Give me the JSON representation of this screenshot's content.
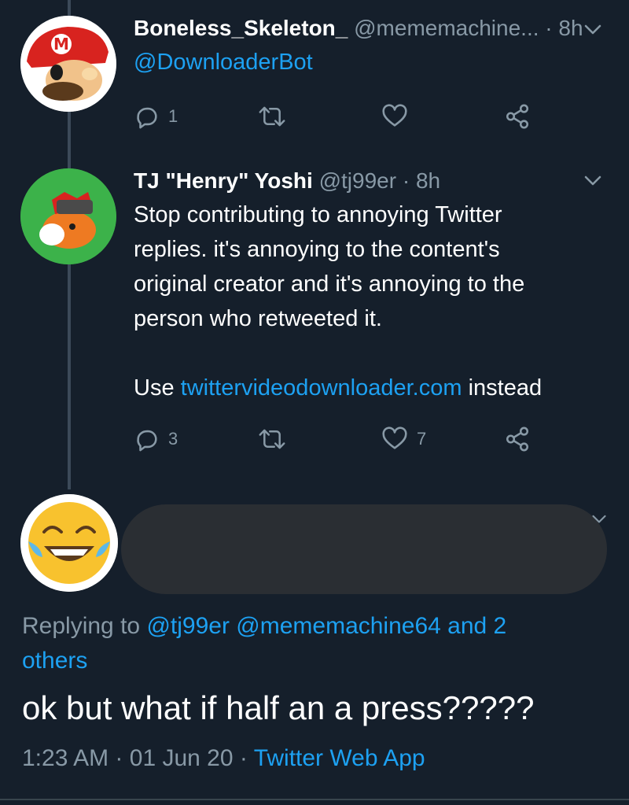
{
  "tweet1": {
    "name": "Boneless_Skeleton_",
    "handle": "@mememachine64",
    "handle_display": "@mememachine...",
    "time": "· 8h",
    "text_mention": "@DownloaderBot",
    "reply_count": "1",
    "retweet_count": "",
    "like_count": ""
  },
  "tweet2": {
    "name": "TJ \"Henry\" Yoshi",
    "handle": "@tj99er",
    "time": "· 8h",
    "text_lines": [
      "Stop contributing to annoying Twitter",
      "replies. it's annoying to the content's",
      "original creator and it's annoying to the",
      "person who retweeted it."
    ],
    "text_use": "Use",
    "text_link": "twittervideodownloader.com",
    "text_instead": "instead",
    "reply_count": "3",
    "retweet_count": "",
    "like_count": "7"
  },
  "main_tweet": {
    "replying_prefix": "Replying to",
    "replying_users": "@tj99er @mememachine64 and 2",
    "replying_others": "others",
    "text": "ok but what if half an a press?????",
    "time": "1:23 AM",
    "sep1": "·",
    "date": "01 Jun 20",
    "sep2": "·",
    "source": "Twitter Web App"
  },
  "icons": [
    "reply-icon",
    "retweet-icon",
    "like-icon",
    "share-icon",
    "chevron-down-icon"
  ],
  "colors": {
    "background": "#151f2b",
    "text": "#ffffff",
    "muted": "#8899a6",
    "link": "#1da1f2",
    "thread_line": "#3c4a59"
  }
}
